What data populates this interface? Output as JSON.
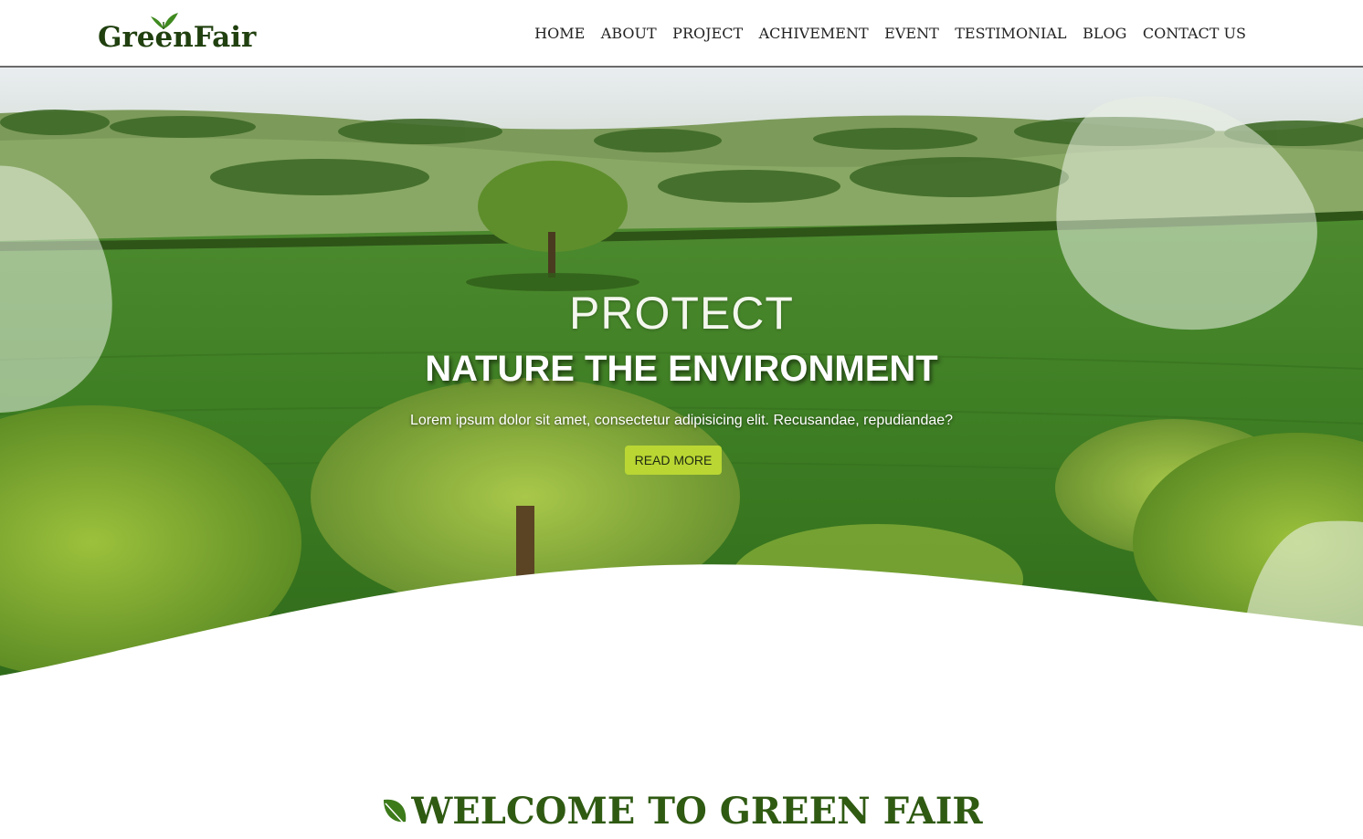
{
  "brand": {
    "name": "GreenFair",
    "color": "#20400f",
    "leaf_icon": "leaf-icon"
  },
  "nav": {
    "items": [
      {
        "label": "HOME"
      },
      {
        "label": "ABOUT"
      },
      {
        "label": "PROJECT"
      },
      {
        "label": "ACHIVEMENT"
      },
      {
        "label": "EVENT"
      },
      {
        "label": "TESTIMONIAL"
      },
      {
        "label": "BLOG"
      },
      {
        "label": "CONTACT US"
      }
    ]
  },
  "hero": {
    "title": "PROTECT",
    "subtitle": "NATURE THE ENVIRONMENT",
    "description": "Lorem ipsum dolor sit amet, consectetur adipisicing elit. Recusandae, repudiandae?",
    "button_label": "READ MORE",
    "button_color": "#b9d633",
    "background": "green-field-landscape-photo"
  },
  "welcome": {
    "title": "WELCOME TO GREEN FAIR",
    "color": "#2f5a12",
    "icon": "leaf-icon"
  }
}
